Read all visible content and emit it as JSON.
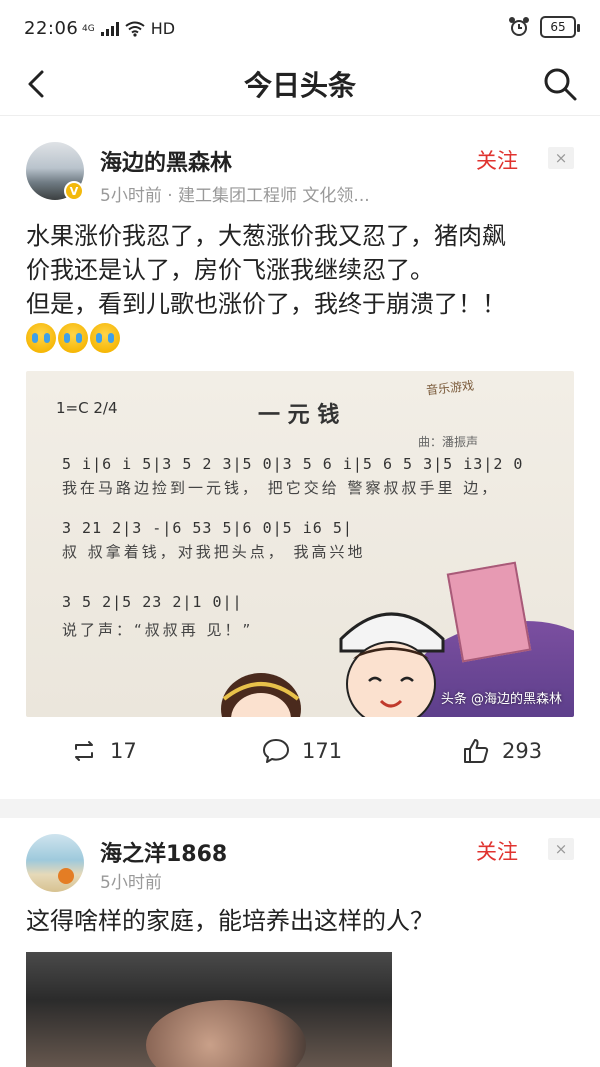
{
  "status": {
    "time": "22:06",
    "network": "4G",
    "hd": "HD",
    "battery": "65"
  },
  "header": {
    "title": "今日头条"
  },
  "posts": [
    {
      "author": "海边的黑森林",
      "meta": "5小时前 · 建工集团工程师 文化领...",
      "follow": "关注",
      "close": "×",
      "text_lines": [
        "水果涨价我忍了，大葱涨价我又忍了，猪肉飙",
        "价我还是认了，房价飞涨我继续忍了。",
        "但是，看到儿歌也涨价了，我终于崩溃了！！"
      ],
      "emoji_count": 3,
      "image": {
        "title": "一 元 钱",
        "key": "1=C 2/4",
        "author_line": "曲：潘振声",
        "game_tag": "音乐游戏",
        "score": [
          "5  i|6 i 5|3 5 2 3|5 0|3 5 6 i|5 6 5 3|5 i3|2 0",
          "3 21 2|3 -|6 53 5|6 0|5 i6 5|",
          "3 5 2|5 23 2|1 0||"
        ],
        "lyrics": [
          "我在马路边捡到一元钱，  把它交给 警察叔叔手里  边，",
          "叔 叔拿着钱，对我把头点，  我高兴地",
          "说了声：“叔叔再    见！”"
        ],
        "watermark": "头条 @海边的黑森林"
      },
      "actions": {
        "repost": "17",
        "comment": "171",
        "like": "293"
      }
    },
    {
      "author": "海之洋1868",
      "meta": "5小时前",
      "follow": "关注",
      "close": "×",
      "text_lines": [
        "这得啥样的家庭，能培养出这样的人？"
      ]
    }
  ]
}
